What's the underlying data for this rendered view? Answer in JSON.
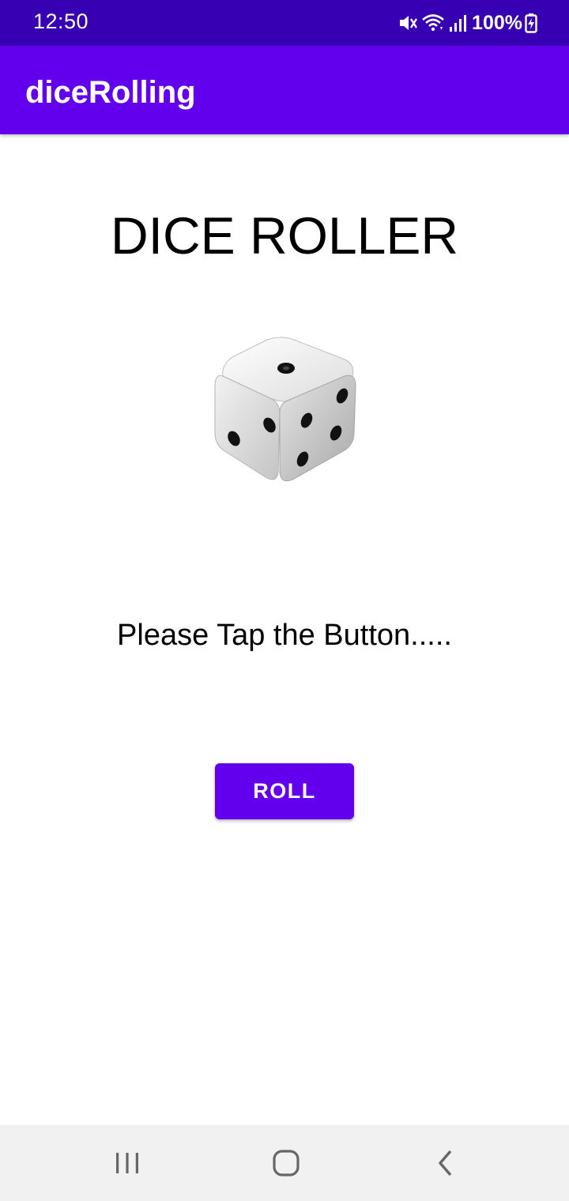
{
  "status_bar": {
    "time": "12:50",
    "battery": "100%",
    "icons": [
      "mute-icon",
      "wifi-icon",
      "signal-icon",
      "battery-charging-icon"
    ],
    "background": "#3700b3"
  },
  "app_bar": {
    "title": "diceRolling",
    "background": "#6200ee"
  },
  "main": {
    "headline": "DICE ROLLER",
    "dice_image": "dice-icon",
    "prompt": "Please Tap the Button.....",
    "roll_button_label": "ROLL",
    "accent_color": "#6200ee"
  },
  "nav_bar": {
    "buttons": [
      "recent-apps-icon",
      "home-icon",
      "back-icon"
    ],
    "background": "#f1f1f1"
  }
}
